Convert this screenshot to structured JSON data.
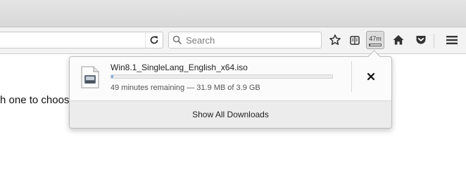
{
  "toolbar": {
    "search_placeholder": "Search",
    "downloads_badge": "47m",
    "download_progress": 0.008,
    "icons": [
      "reload-icon",
      "search-icon",
      "star-icon",
      "reading-list-icon",
      "downloads-icon",
      "home-icon",
      "pocket-icon",
      "hamburger-menu-icon"
    ]
  },
  "page": {
    "body_text": "h one to choose, refer to FAQ"
  },
  "downloads_panel": {
    "filename": "Win8.1_SingleLang_English_x64.iso",
    "progress_fraction": 0.008,
    "status": "49 minutes remaining — 31.9 MB of 3.9 GB",
    "footer_label": "Show All Downloads"
  },
  "colors": {
    "progress_fill": "#8ab1e0",
    "toolbar_bg": "#f3f3f3"
  }
}
